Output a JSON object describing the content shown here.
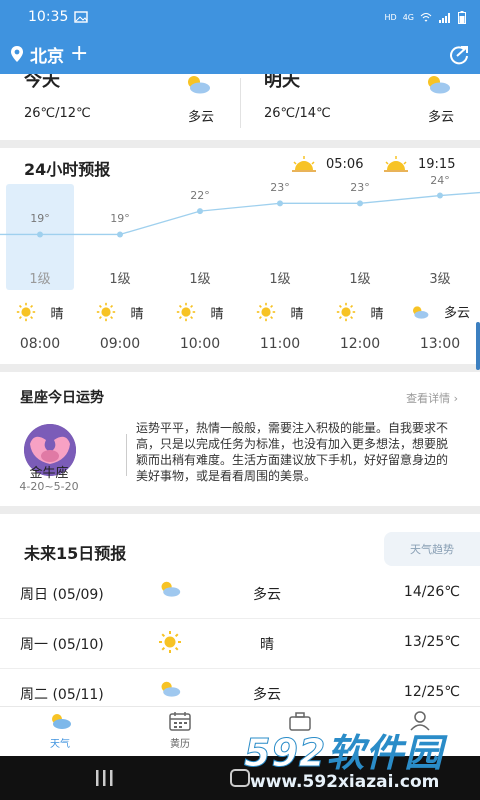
{
  "status": {
    "time": "10:35",
    "hd": "HD",
    "net": "4G"
  },
  "header": {
    "city": "北京",
    "plus": "+"
  },
  "days": [
    {
      "name": "今天",
      "temp": "26℃/12℃",
      "cond": "多云",
      "icon": "cloud-sun-icon"
    },
    {
      "name": "明天",
      "temp": "26℃/14℃",
      "cond": "多云",
      "icon": "cloud-sun-icon"
    }
  ],
  "hourly": {
    "title": "24小时预报",
    "sunrise": "05:06",
    "sunset": "19:15",
    "hours": [
      {
        "temp": "19°",
        "temp_value": 19,
        "wind": "1级",
        "cond": "晴",
        "icon": "sun-icon",
        "time": "08:00"
      },
      {
        "temp": "19°",
        "temp_value": 19,
        "wind": "1级",
        "cond": "晴",
        "icon": "sun-icon",
        "time": "09:00"
      },
      {
        "temp": "22°",
        "temp_value": 22,
        "wind": "1级",
        "cond": "晴",
        "icon": "sun-icon",
        "time": "10:00"
      },
      {
        "temp": "23°",
        "temp_value": 23,
        "wind": "1级",
        "cond": "晴",
        "icon": "sun-icon",
        "time": "11:00"
      },
      {
        "temp": "23°",
        "temp_value": 23,
        "wind": "1级",
        "cond": "晴",
        "icon": "sun-icon",
        "time": "12:00"
      },
      {
        "temp": "24°",
        "temp_value": 24,
        "wind": "3级",
        "cond": "多云",
        "icon": "cloud-sun-icon",
        "time": "13:00"
      }
    ]
  },
  "horoscope": {
    "title": "星座今日运势",
    "more": "查看详情",
    "sign": "金牛座",
    "dates": "4-20~5-20",
    "text": "运势平平，热情一般般，需要注入积极的能量。自我要求不高，只是以完成任务为标准，也没有加入更多想法，想要脱颖而出稍有难度。生活方面建议放下手机，好好留意身边的美好事物，或是看看周围的美景。"
  },
  "forecast": {
    "title": "未来15日预报",
    "trend_button": "天气趋势",
    "rows": [
      {
        "date": "周日 (05/09)",
        "cond": "多云",
        "icon": "cloud-sun-icon",
        "temp": "14/26℃"
      },
      {
        "date": "周一 (05/10)",
        "cond": "晴",
        "icon": "sun-icon",
        "temp": "13/25℃"
      },
      {
        "date": "周二 (05/11)",
        "cond": "多云",
        "icon": "cloud-sun-icon",
        "temp": "12/25℃"
      }
    ]
  },
  "tabs": [
    {
      "label": "天气",
      "icon": "weather-tab-icon"
    },
    {
      "label": "黄历",
      "icon": "calendar-tab-icon"
    },
    {
      "label": "",
      "icon": "briefcase-tab-icon"
    },
    {
      "label": "",
      "icon": "profile-tab-icon"
    }
  ],
  "watermark": {
    "brand_num": "592",
    "brand_text": "软件园",
    "url": "www.592xiazai.com"
  },
  "colors": {
    "primary": "#3f93df",
    "sun": "#f7c325",
    "cloud": "#9fc8ef"
  }
}
